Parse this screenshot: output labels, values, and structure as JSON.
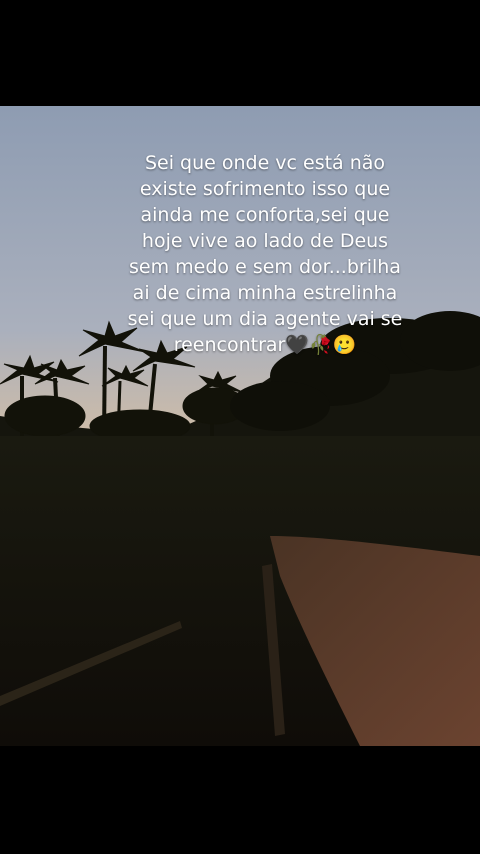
{
  "caption": {
    "lines": [
      "Sei que onde vc está não",
      "existe sofrimento isso que",
      "ainda me conforta,sei que",
      "hoje vive ao lado de Deus",
      "sem medo e sem dor...brilha",
      "ai de cima minha estrelinha",
      "sei que um dia agente vai se",
      "reencontrar🖤🥀🥲"
    ]
  },
  "colors": {
    "sky_top": "#8f9db3",
    "sky_mid": "#c8b9a8",
    "sky_horizon": "#e7c38a",
    "foliage": "#111209",
    "road": "#5a3a28"
  }
}
